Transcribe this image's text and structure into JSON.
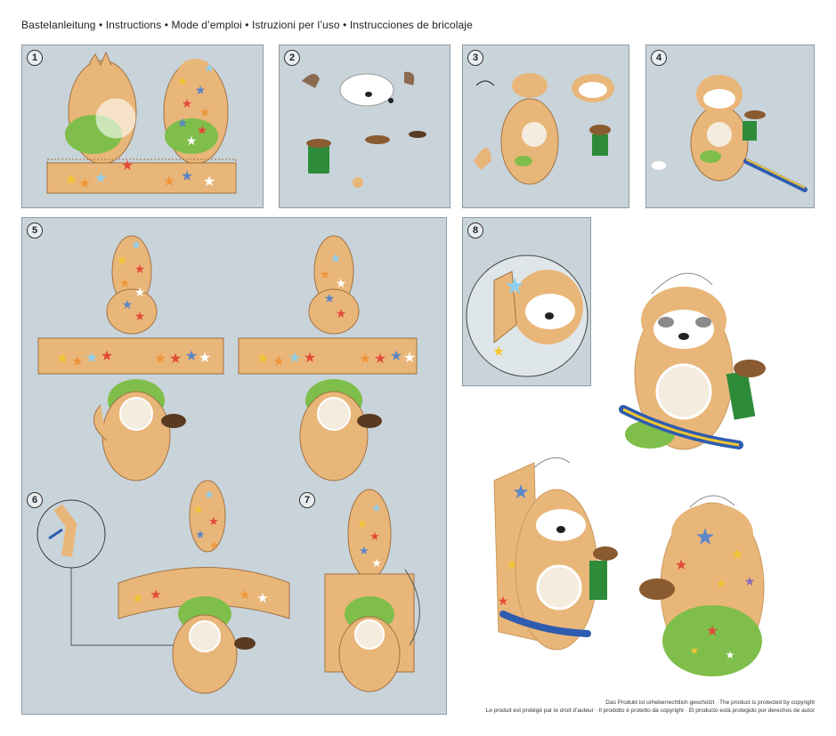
{
  "header": {
    "title": "Bastelanleitung • Instructions • Mode d’emploi • Istruzioni per l’uso • Instrucciones de bricolaje"
  },
  "steps": [
    "1",
    "2",
    "3",
    "4",
    "5",
    "6",
    "7",
    "8"
  ],
  "copyright": {
    "line1": "Das Produkt ist urheberrechtlich geschützt · The product is protected by copyright",
    "line2": "Le produit est protégé par le droit d’auteur · Il prodotto è protetto da copyright · El producto está protegido por derechos de autor"
  },
  "colors": {
    "panel_bg": "#c9d3da",
    "sloth_fur": "#e9b679",
    "sloth_dark": "#b8864f",
    "belly": "#f4ecdf",
    "bush_green": "#7fbe4a",
    "star_blue": "#5b86c8",
    "star_yellow": "#f2c531",
    "star_red": "#e24a3a",
    "star_orange": "#f0963a"
  }
}
